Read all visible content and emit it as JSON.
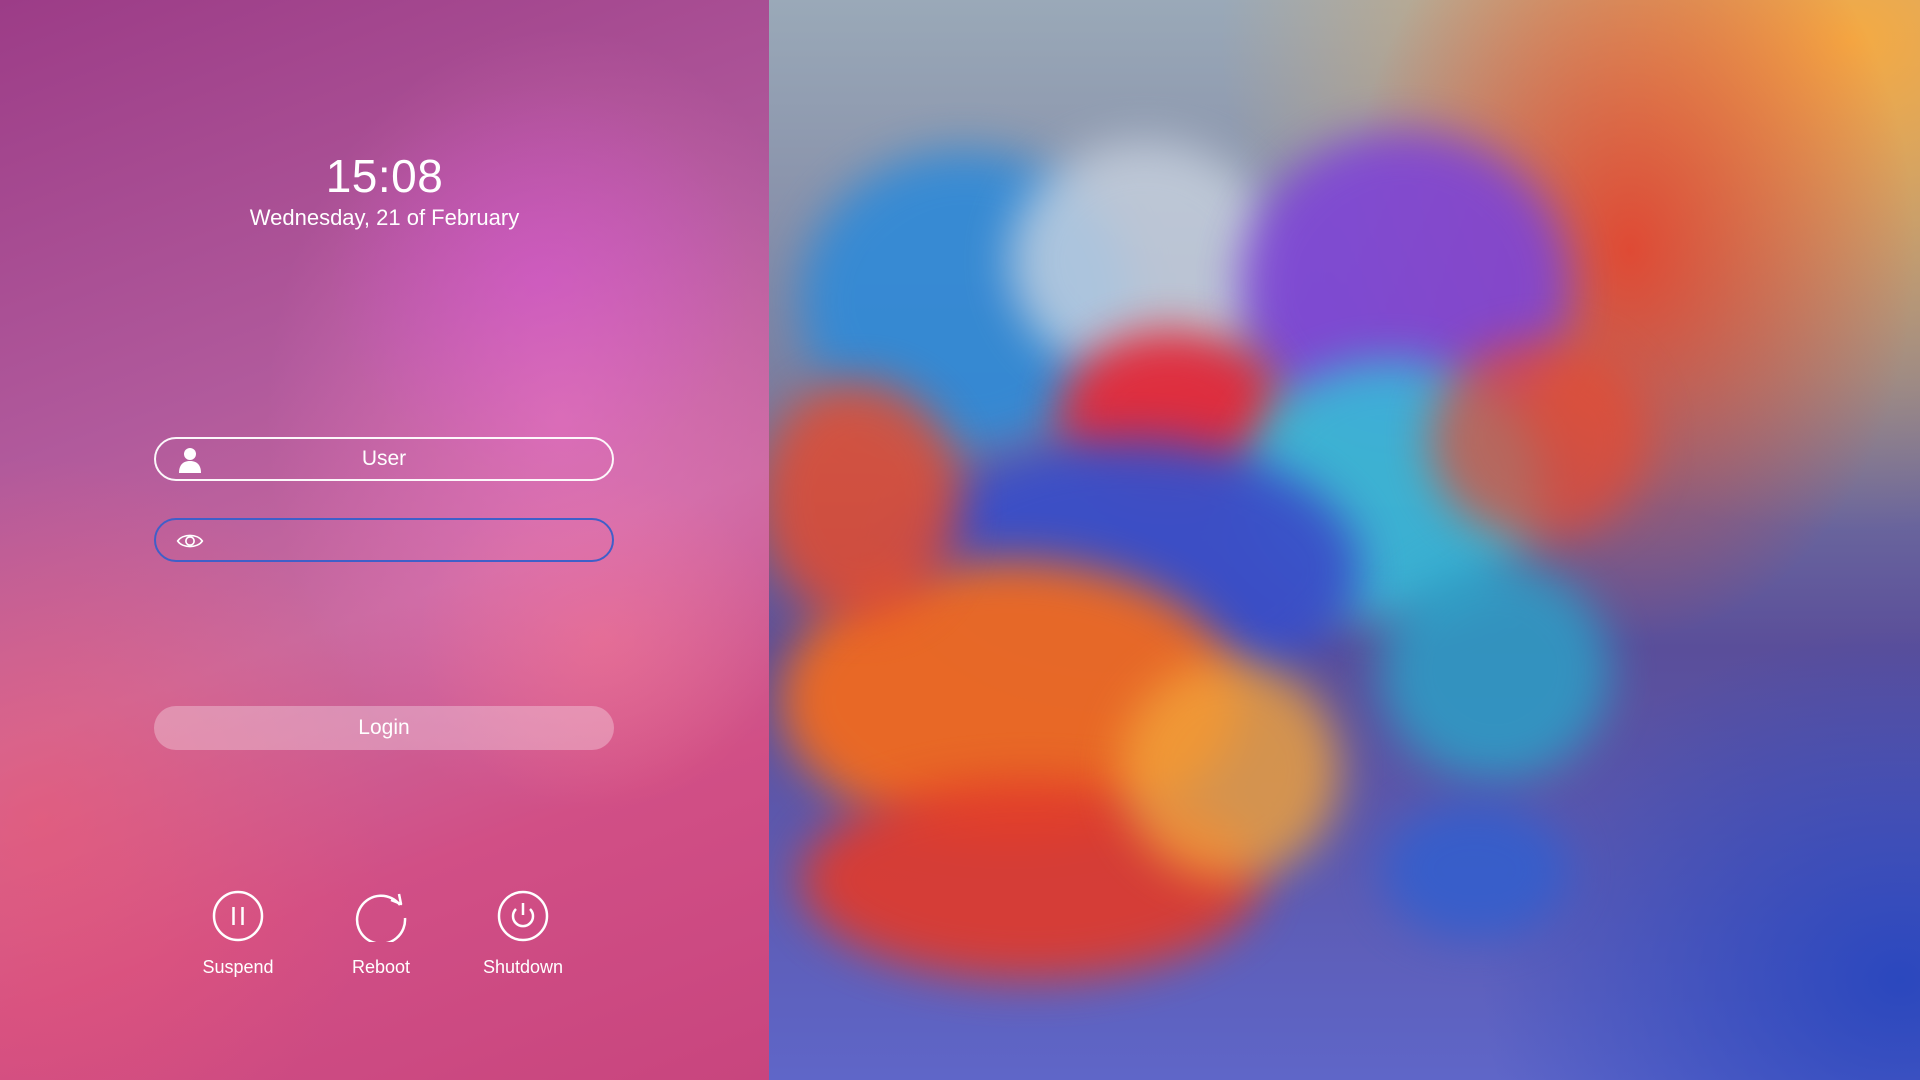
{
  "clock": {
    "time": "15:08",
    "date": "Wednesday, 21 of February"
  },
  "login_form": {
    "username": {
      "label": "User",
      "icon": "user-icon"
    },
    "password": {
      "value": "",
      "icon": "eye-icon"
    },
    "login_label": "Login"
  },
  "power": {
    "suspend": {
      "label": "Suspend",
      "icon": "pause-icon"
    },
    "reboot": {
      "label": "Reboot",
      "icon": "reboot-icon"
    },
    "shutdown": {
      "label": "Shutdown",
      "icon": "power-icon"
    }
  },
  "colors": {
    "text": "#ffffff",
    "password_border": "#3f5fc9",
    "panel_tint": "#b15a9c"
  }
}
